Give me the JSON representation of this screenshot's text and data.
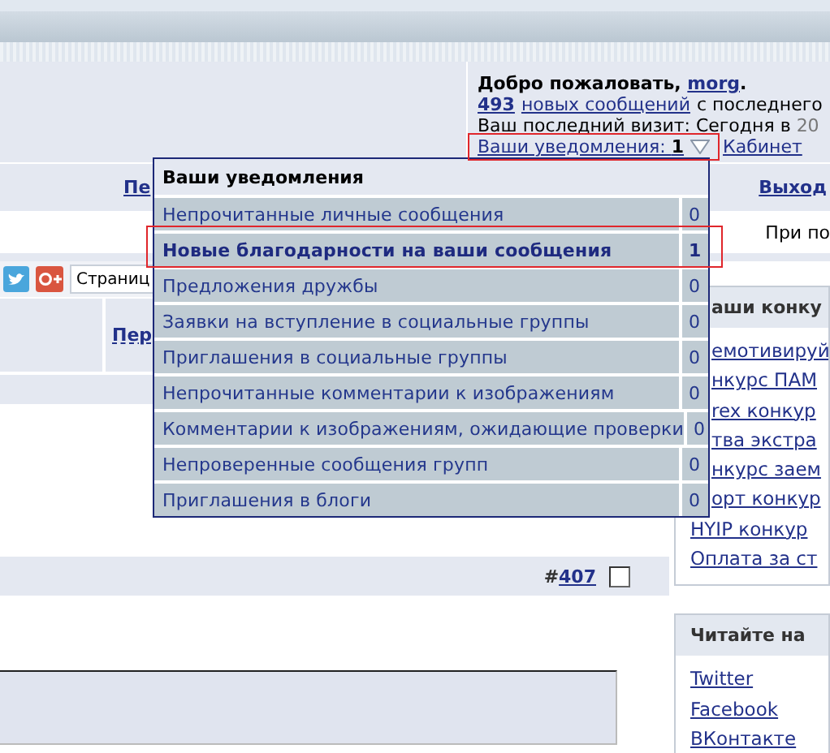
{
  "welcome": {
    "greeting_prefix": "Добро пожаловать,",
    "username": "morg",
    "greeting_suffix": ".",
    "new_count": "493",
    "new_posts_link": "новых сообщений",
    "new_posts_suffix": "с последнего",
    "last_visit": "Ваш последний визит: Сегодня в",
    "last_visit_time": "20",
    "notifications_link": "Ваши уведомления:",
    "notifications_count": "1",
    "notifications_highlighted": true,
    "cabinet_link": "Кабинет"
  },
  "nav": {
    "left_link": "Пе",
    "logout_link": "Выход"
  },
  "notice": "При по",
  "share": {
    "page_label": "Страниц"
  },
  "table_header": {
    "column_link": "Пер"
  },
  "post": {
    "number_prefix": "#",
    "number": "407",
    "checked": false
  },
  "sidebar": [
    {
      "title": "аши конку",
      "links": [
        "емотивируй",
        "нкурс ПАМ",
        "rex конкур",
        "тва экстра",
        "нкурс заем",
        "орт конкур",
        "HYIP конкур",
        "Оплата за ст"
      ]
    },
    {
      "title": "Читайте на",
      "links": [
        "Twitter",
        "Facebook",
        "ВКонтакте"
      ]
    }
  ],
  "popup": {
    "title": "Ваши уведомления",
    "items": [
      {
        "label": "Непрочитанные личные сообщения",
        "count": "0",
        "new": false,
        "highlighted": false
      },
      {
        "label": "Новые благодарности на ваши сообщения",
        "count": "1",
        "new": true,
        "highlighted": true
      },
      {
        "label": "Предложения дружбы",
        "count": "0",
        "new": false,
        "highlighted": false
      },
      {
        "label": "Заявки на вступление в социальные группы",
        "count": "0",
        "new": false,
        "highlighted": false
      },
      {
        "label": "Приглашения в социальные группы",
        "count": "0",
        "new": false,
        "highlighted": false
      },
      {
        "label": "Непрочитанные комментарии к изображениям",
        "count": "0",
        "new": false,
        "highlighted": false
      },
      {
        "label": "Комментарии к изображениям, ожидающие проверки",
        "count": "0",
        "new": false,
        "highlighted": false
      },
      {
        "label": "Непроверенные сообщения групп",
        "count": "0",
        "new": false,
        "highlighted": false
      },
      {
        "label": "Приглашения в блоги",
        "count": "0",
        "new": false,
        "highlighted": false
      }
    ]
  }
}
